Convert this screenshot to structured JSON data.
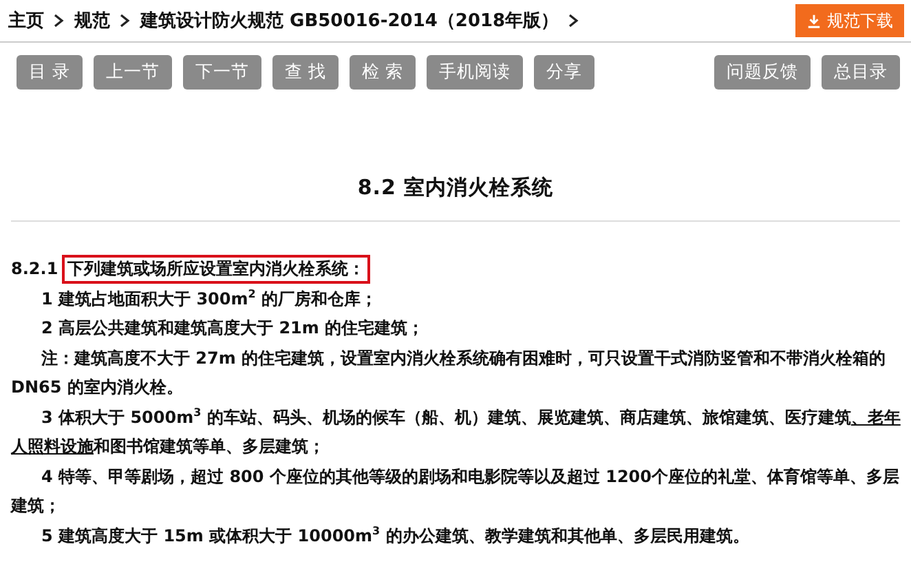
{
  "breadcrumb": [
    {
      "label": "主页"
    },
    {
      "label": "规范"
    },
    {
      "label": "建筑设计防火规范 GB50016-2014（2018年版）"
    }
  ],
  "download_button": {
    "label": "规范下载"
  },
  "toolbar": {
    "left": [
      {
        "label": "目 录"
      },
      {
        "label": "上一节"
      },
      {
        "label": "下一节"
      },
      {
        "label": "查 找"
      },
      {
        "label": "检 索"
      },
      {
        "label": "手机阅读"
      },
      {
        "label": "分享"
      }
    ],
    "right": [
      {
        "label": "问题反馈"
      },
      {
        "label": "总目录"
      }
    ]
  },
  "section_title": "8.2 室内消火栓系统",
  "paragraphs": [
    {
      "kind": "clause",
      "number": "8.2.1",
      "highlighted": true,
      "parts": [
        {
          "text": "下列建筑或场所应设置室内消火栓系统：",
          "underlined": false
        }
      ]
    },
    {
      "kind": "item",
      "parts": [
        {
          "text": "1 建筑占地面积大于 300m$^{2}$ 的厂房和仓库；",
          "underlined": false
        }
      ]
    },
    {
      "kind": "item",
      "parts": [
        {
          "text": "2 高层公共建筑和建筑高度大于 21m 的住宅建筑；",
          "underlined": false
        }
      ]
    },
    {
      "kind": "item",
      "parts": [
        {
          "text": "注：建筑高度不大于 27m 的住宅建筑，设置室内消火栓系统确有困难时，可只设置干式消防竖管和不带消火栓箱的 DN65 的室内消火栓。",
          "underlined": false
        }
      ]
    },
    {
      "kind": "item",
      "parts": [
        {
          "text": "3 体积大于 5000m$^{3}$ 的车站、码头、机场的候车（船、机）建筑、展览建筑、商店建筑、旅馆建筑、医疗建筑",
          "underlined": false
        },
        {
          "text": "、老年人照料设施",
          "underlined": true
        },
        {
          "text": "和图书馆建筑等单、多层建筑；",
          "underlined": false
        }
      ]
    },
    {
      "kind": "item",
      "parts": [
        {
          "text": "4 特等、甲等剧场，超过 800 个座位的其他等级的剧场和电影院等以及超过 1200个座位的礼堂、体育馆等单、多层建筑；",
          "underlined": false
        }
      ]
    },
    {
      "kind": "item",
      "parts": [
        {
          "text": "5 建筑高度大于 15m 或体积大于 10000m$^{3}$ 的办公建筑、教学建筑和其他单、多层民用建筑。",
          "underlined": false
        }
      ]
    }
  ]
}
